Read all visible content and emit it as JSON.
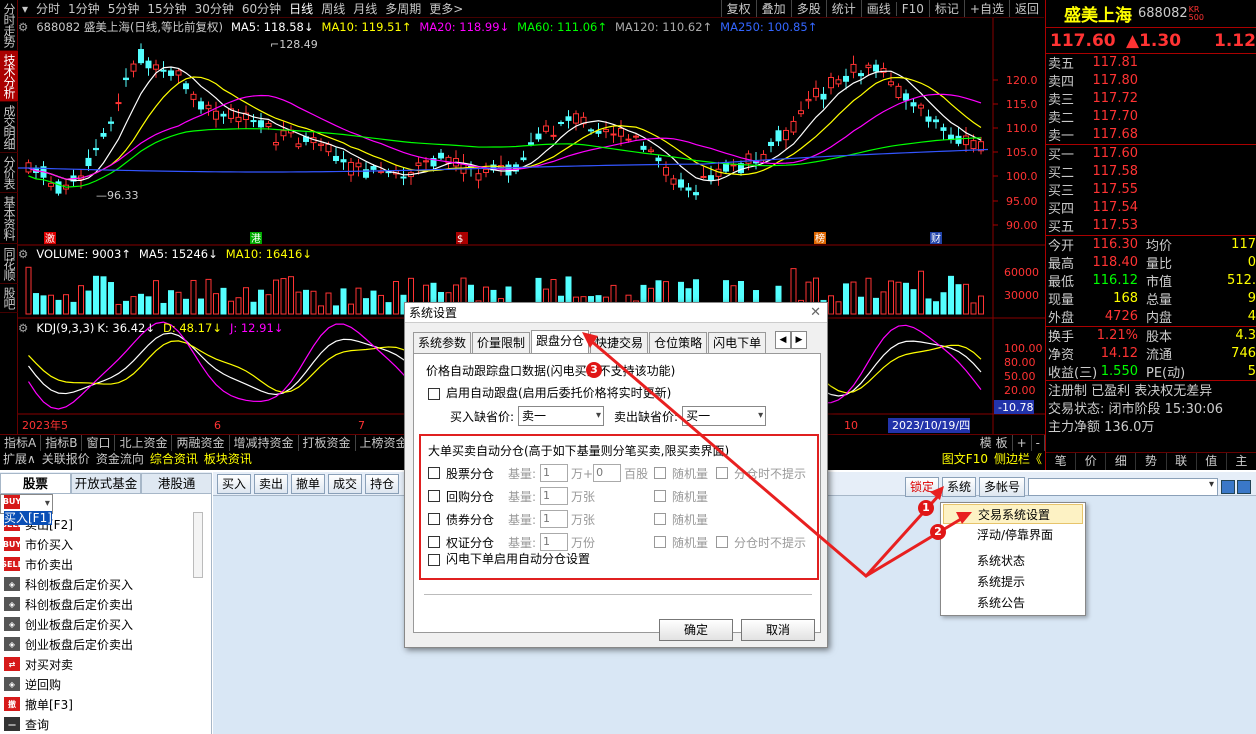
{
  "vertical_tabs": [
    "分时走势",
    "技术分析",
    "成交明细",
    "分价表",
    "基本资料",
    "同花顺",
    "股吧"
  ],
  "vertical_active": 1,
  "periods": [
    "分时",
    "1分钟",
    "5分钟",
    "15分钟",
    "30分钟",
    "60分钟",
    "日线",
    "周线",
    "月线",
    "多周期",
    "更多>"
  ],
  "period_active": 6,
  "tools": [
    "复权",
    "叠加",
    "多股",
    "统计",
    "画线",
    "F10",
    "标记",
    "+自选",
    "返回"
  ],
  "chart_info": {
    "code_name": "688082 盛美上海(日线,等比前复权)",
    "ma5": "MA5: 118.58↓",
    "ma10": "MA10: 119.51↑",
    "ma20": "MA20: 118.99↓",
    "ma60": "MA60: 111.06↑",
    "ma120": "MA120: 110.62↑",
    "ma250": "MA250: 100.85↑"
  },
  "price_axis": [
    "120.0",
    "115.0",
    "110.0",
    "105.0",
    "100.0",
    "95.00",
    "90.00"
  ],
  "high_label": "128.49",
  "low_label": "96.33",
  "event_marks": [
    "激",
    "港",
    "$",
    "榜",
    "财"
  ],
  "volume_info": {
    "title": "VOLUME: 9003↑",
    "ma5": "MA5: 15246↓",
    "ma10": "MA10: 16416↓"
  },
  "volume_axis": [
    "60000",
    "30000"
  ],
  "kdj_info": {
    "title": "KDJ(9,3,3)",
    "k": "K: 36.42↓",
    "d": "D: 48.17↓",
    "j": "J: 12.91↓"
  },
  "kdj_axis": [
    "100.00",
    "80.00",
    "50.00",
    "20.00"
  ],
  "date_axis": {
    "start": "2023年5",
    "m6": "6",
    "m7": "7",
    "m10": "10",
    "cursor": "2023/10/19/四",
    "cursor_value": "-10.78"
  },
  "bottom_tabs": [
    "指标A",
    "指标B",
    "窗口",
    "北上资金",
    "两融资金",
    "增减持资金",
    "打板资金",
    "上榜资金"
  ],
  "bottom_tabs2": [
    "扩展∧",
    "关联报价",
    "资金流向",
    "综合资讯",
    "板块资讯"
  ],
  "bottom_right": [
    "模 板",
    "+",
    "-"
  ],
  "bottom_right2": [
    "图文F10",
    "侧边栏《"
  ],
  "quote": {
    "name": "盛美上海",
    "code": "688082",
    "mk_top": "KR",
    "mk_bot": "500",
    "price": "117.60",
    "change": "▲1.30",
    "pct": "1.12",
    "asks": [
      [
        "卖五",
        "117.81"
      ],
      [
        "卖四",
        "117.80"
      ],
      [
        "卖三",
        "117.72"
      ],
      [
        "卖二",
        "117.70"
      ],
      [
        "卖一",
        "117.68"
      ]
    ],
    "bids": [
      [
        "买一",
        "117.60"
      ],
      [
        "买二",
        "117.58"
      ],
      [
        "买三",
        "117.55"
      ],
      [
        "买四",
        "117.54"
      ],
      [
        "买五",
        "117.53"
      ]
    ],
    "stats": [
      [
        "今开",
        "116.30",
        "均价",
        "117"
      ],
      [
        "最高",
        "118.40",
        "量比",
        "0"
      ],
      [
        "最低",
        "116.12",
        "市值",
        "512."
      ],
      [
        "现量",
        "168",
        "总量",
        "9"
      ],
      [
        "外盘",
        "4726",
        "内盘",
        "4"
      ]
    ],
    "stats2": [
      [
        "换手",
        "1.21%",
        "股本",
        "4.3"
      ],
      [
        "净资",
        "14.12",
        "流通",
        "746"
      ],
      [
        "收益(三)",
        "1.550",
        "PE(动)",
        "5"
      ]
    ],
    "notes": [
      "注册制 已盈利 表决权无差异",
      "交易状态: 闭市阶段 15:30:06",
      "主力净额 136.0万"
    ],
    "right_tabs": [
      "笔",
      "价",
      "细",
      "势",
      "联",
      "值",
      "主"
    ]
  },
  "trade": {
    "left_tabs": [
      "股票",
      "开放式基金",
      "港股通"
    ],
    "tree": [
      {
        "icon": "BUY",
        "color": "#d61a1a",
        "label": "买入[F1]"
      },
      {
        "icon": "SELL",
        "color": "#d61a1a",
        "label": "卖出[F2]"
      },
      {
        "icon": "BUY",
        "color": "#d61a1a",
        "label": "市价买入"
      },
      {
        "icon": "SELL",
        "color": "#d61a1a",
        "label": "市价卖出"
      },
      {
        "icon": "◈",
        "color": "#555",
        "label": "科创板盘后定价买入"
      },
      {
        "icon": "◈",
        "color": "#555",
        "label": "科创板盘后定价卖出"
      },
      {
        "icon": "◈",
        "color": "#555",
        "label": "创业板盘后定价买入"
      },
      {
        "icon": "◈",
        "color": "#555",
        "label": "创业板盘后定价卖出"
      },
      {
        "icon": "⇄",
        "color": "#d61a1a",
        "label": "对买对卖"
      },
      {
        "icon": "◈",
        "color": "#555",
        "label": "逆回购"
      },
      {
        "icon": "撤",
        "color": "#d61a1a",
        "label": "撤单[F3]"
      },
      {
        "icon": "—",
        "color": "#333",
        "label": "查询"
      }
    ],
    "toolbar": [
      "买入",
      "卖出",
      "撤单",
      "成交",
      "持仓"
    ],
    "lock": "锁定",
    "system": "系统",
    "multi": "多帐号"
  },
  "menu": [
    "交易系统设置",
    "浮动/停靠界面",
    "系统状态",
    "系统提示",
    "系统公告"
  ],
  "dialog": {
    "title": "系统设置",
    "tabs": [
      "系统参数",
      "价量限制",
      "跟盘分仓",
      "快捷交易",
      "仓位策略",
      "闪电下单"
    ],
    "section1": "价格自动跟踪盘口数据(闪电买卖不支持该功能)",
    "auto_track": "启用自动跟盘(启用后委托价格将实时更新)",
    "buy_default_label": "买入缺省价:",
    "buy_default": "卖一",
    "sell_default_label": "卖出缺省价:",
    "sell_default": "买一",
    "section2": "大单买卖自动分仓(高于如下基量则分笔买卖,限买卖界面)",
    "rows": [
      {
        "name": "股票分仓",
        "base": "基量:",
        "v1": "1",
        "u1": "万+",
        "v2": "0",
        "u2": "百股",
        "rand": "随机量",
        "nohint": "分仓时不提示"
      },
      {
        "name": "回购分仓",
        "base": "基量:",
        "v1": "1",
        "u1": "万张",
        "rand": "随机量"
      },
      {
        "name": "债券分仓",
        "base": "基量:",
        "v1": "1",
        "u1": "万张",
        "rand": "随机量"
      },
      {
        "name": "权证分仓",
        "base": "基量:",
        "v1": "1",
        "u1": "万份",
        "rand": "随机量",
        "nohint": "分仓时不提示"
      }
    ],
    "flash": "闪电下单启用自动分仓设置",
    "ok": "确定",
    "cancel": "取消"
  },
  "badges": [
    "1",
    "2",
    "3"
  ],
  "colors": {
    "accent_red": "#e01616",
    "up": "#ff3333",
    "down": "#54ffff",
    "ma5": "#ffffff",
    "ma10": "#ffff00",
    "ma20": "#ff00ff",
    "ma60": "#00ff00",
    "ma120": "#aaaaaa",
    "ma250": "#3355ff"
  }
}
